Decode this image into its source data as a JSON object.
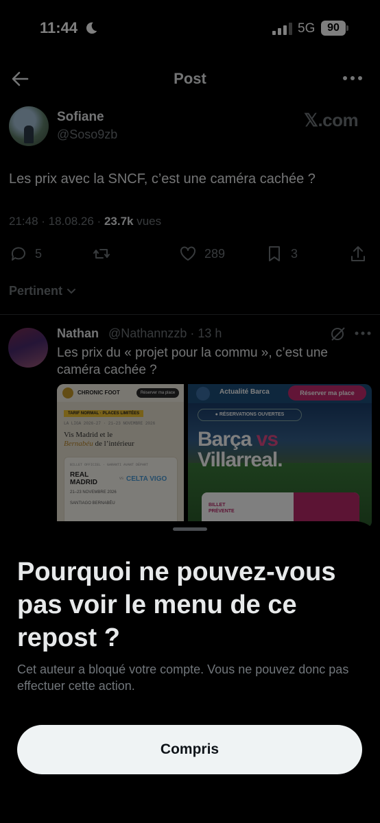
{
  "status_bar": {
    "time": "11:44",
    "network": "5G",
    "battery": "90"
  },
  "header": {
    "title": "Post"
  },
  "post": {
    "author_name": "Sofiane",
    "author_handle": "@Soso9zb",
    "source": "𝕏.com",
    "text": "Les prix avec la SNCF, c’est une caméra cachée ?",
    "datetime": "21:48 · 18.08.26 · ",
    "views": "23.7k",
    "views_label": " vues",
    "replies": "5",
    "reposts": "",
    "likes": "289",
    "bookmarks": "3"
  },
  "sort": {
    "label": "Pertinent"
  },
  "reply": {
    "author_name": "Nathan",
    "author_handle": "@Nathannzzb · 13 h",
    "text": "Les prix du « projet pour la commu », c’est une caméra cachée ?",
    "image1": {
      "brand": "CHRONIC FOOT",
      "button": "Réserver ma place",
      "tag": "TARIF NORMAL · PLACES LIMITÉES",
      "league": "LA LIGA 2026-27 · 21–23 NOVEMBRE 2026",
      "headline_line1": "Vis Madrid et le",
      "headline_italic": "Bernabéu",
      "headline_rest": " de l’intérieur",
      "ticket_small": "BILLET OFFICIEL · GARANTI AVANT DÉPART",
      "home_line1": "REAL",
      "home_line2": "MADRID",
      "vs": "vs",
      "away": "CELTA VIGO",
      "date": "21–23 NOVEMBRE 2026",
      "venue": "SANTIAGO BERNABÉU"
    },
    "image2": {
      "brand": "Actualité Barca",
      "button": "Réserver ma place",
      "open": "● RÉSERVATIONS OUVERTES",
      "title_line1": "Barça ",
      "title_vs": "vs",
      "title_line2": "Villarreal.",
      "card_label_line1": "BILLET",
      "card_label_line2": "PRÉVENTE"
    }
  },
  "sheet": {
    "title": "Pourquoi ne pouvez-vous pas voir le menu de ce repost ?",
    "body": "Cet auteur a bloqué votre compte. Vous ne pouvez donc pas effectuer cette action.",
    "button": "Compris"
  }
}
